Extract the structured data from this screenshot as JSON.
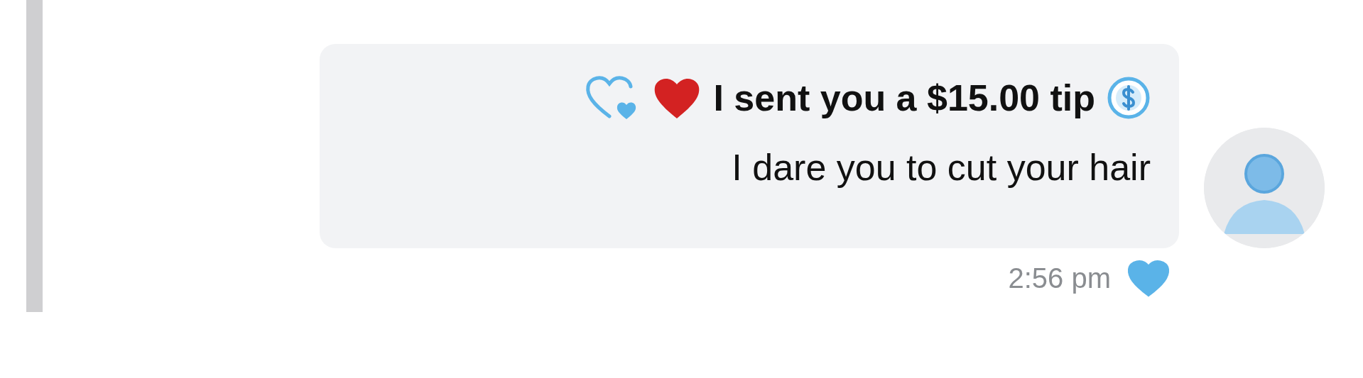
{
  "message": {
    "tip_text": "I sent you a $15.00 tip",
    "text": "I dare you to cut your hair",
    "time": "2:56 pm",
    "liked": true
  }
}
